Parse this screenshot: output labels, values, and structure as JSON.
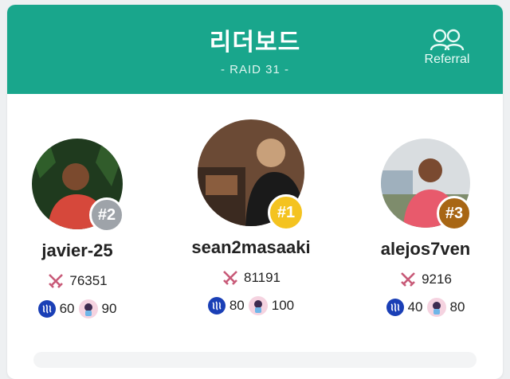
{
  "header": {
    "title": "리더보드",
    "subtitle": "- RAID 31 -",
    "referral_label": "Referral",
    "background": "#19a68c"
  },
  "players": [
    {
      "rank": "#2",
      "name": "javier-25",
      "sword_score": "76351",
      "steem": "60",
      "pet": "90",
      "rank_color": "#9ea3a9"
    },
    {
      "rank": "#1",
      "name": "sean2masaaki",
      "sword_score": "81191",
      "steem": "80",
      "pet": "100",
      "rank_color": "#f4c320"
    },
    {
      "rank": "#3",
      "name": "alejos7ven",
      "sword_score": "9216",
      "steem": "40",
      "pet": "80",
      "rank_color": "#a86614"
    }
  ],
  "icons": {
    "sword": "crossed-swords-icon",
    "steem": "steem-icon",
    "pet": "pet-character-icon",
    "referral": "users-icon"
  }
}
